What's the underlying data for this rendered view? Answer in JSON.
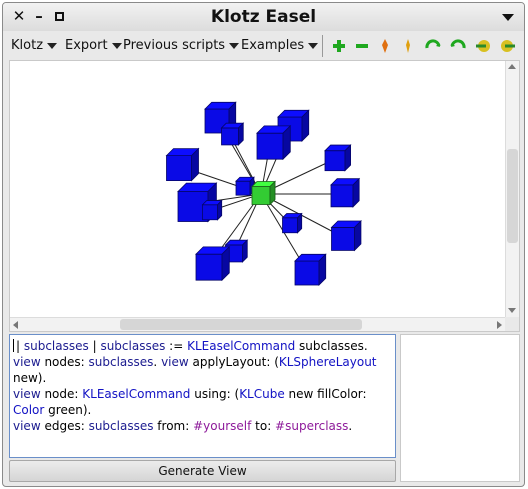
{
  "window": {
    "title": "Klotz Easel"
  },
  "menubar": {
    "items": [
      {
        "label": "Klotz"
      },
      {
        "label": "Export"
      },
      {
        "label": "Previous scripts"
      },
      {
        "label": "Examples"
      }
    ]
  },
  "toolbar": {
    "tools": [
      {
        "icon": "zoom-in-icon",
        "color": "#1fa81f"
      },
      {
        "icon": "zoom-out-icon",
        "color": "#1fa81f"
      },
      {
        "icon": "pin-icon",
        "color": "#e07010"
      },
      {
        "icon": "pin-alt-icon",
        "color": "#e0a010"
      },
      {
        "icon": "rotate-left-icon",
        "color": "#1fa81f"
      },
      {
        "icon": "rotate-right-icon",
        "color": "#1fa81f"
      },
      {
        "icon": "pan-left-icon",
        "color": "#c8a010"
      },
      {
        "icon": "pan-right-icon",
        "color": "#c8a010"
      }
    ]
  },
  "graph": {
    "center_color": "#33cc33",
    "node_color": "#0a0ae6",
    "edge_color": "#222222"
  },
  "editor": {
    "lines": [
      [
        {
          "t": "| ",
          "c": "plain"
        },
        {
          "t": "subclasses",
          "c": "kw"
        },
        {
          "t": " | ",
          "c": "plain"
        },
        {
          "t": "subclasses",
          "c": "kw"
        },
        {
          "t": " := ",
          "c": "plain"
        },
        {
          "t": "KLEaselCommand",
          "c": "cls"
        },
        {
          "t": " subclasses.",
          "c": "plain"
        }
      ],
      [
        {
          "t": "view",
          "c": "kw"
        },
        {
          "t": " nodes: ",
          "c": "plain"
        },
        {
          "t": "subclasses",
          "c": "kw"
        },
        {
          "t": ". ",
          "c": "plain"
        },
        {
          "t": "view",
          "c": "kw"
        },
        {
          "t": " applyLayout: (",
          "c": "plain"
        },
        {
          "t": "KLSphereLayout",
          "c": "cls"
        }
      ],
      [
        {
          "t": "new).",
          "c": "plain"
        }
      ],
      [
        {
          "t": "view",
          "c": "kw"
        },
        {
          "t": " node: ",
          "c": "plain"
        },
        {
          "t": "KLEaselCommand",
          "c": "cls"
        },
        {
          "t": " using: (",
          "c": "plain"
        },
        {
          "t": "KLCube",
          "c": "cls"
        },
        {
          "t": " new fillColor:",
          "c": "plain"
        }
      ],
      [
        {
          "t": "Color",
          "c": "cls"
        },
        {
          "t": " green).",
          "c": "plain"
        }
      ],
      [
        {
          "t": "view",
          "c": "kw"
        },
        {
          "t": " edges: ",
          "c": "plain"
        },
        {
          "t": "subclasses",
          "c": "kw"
        },
        {
          "t": " from: ",
          "c": "plain"
        },
        {
          "t": "#yourself",
          "c": "sym"
        },
        {
          "t": " to: ",
          "c": "plain"
        },
        {
          "t": "#superclass",
          "c": "sym"
        },
        {
          "t": ".",
          "c": "plain"
        }
      ]
    ]
  },
  "generate_button": {
    "label": "Generate View"
  }
}
